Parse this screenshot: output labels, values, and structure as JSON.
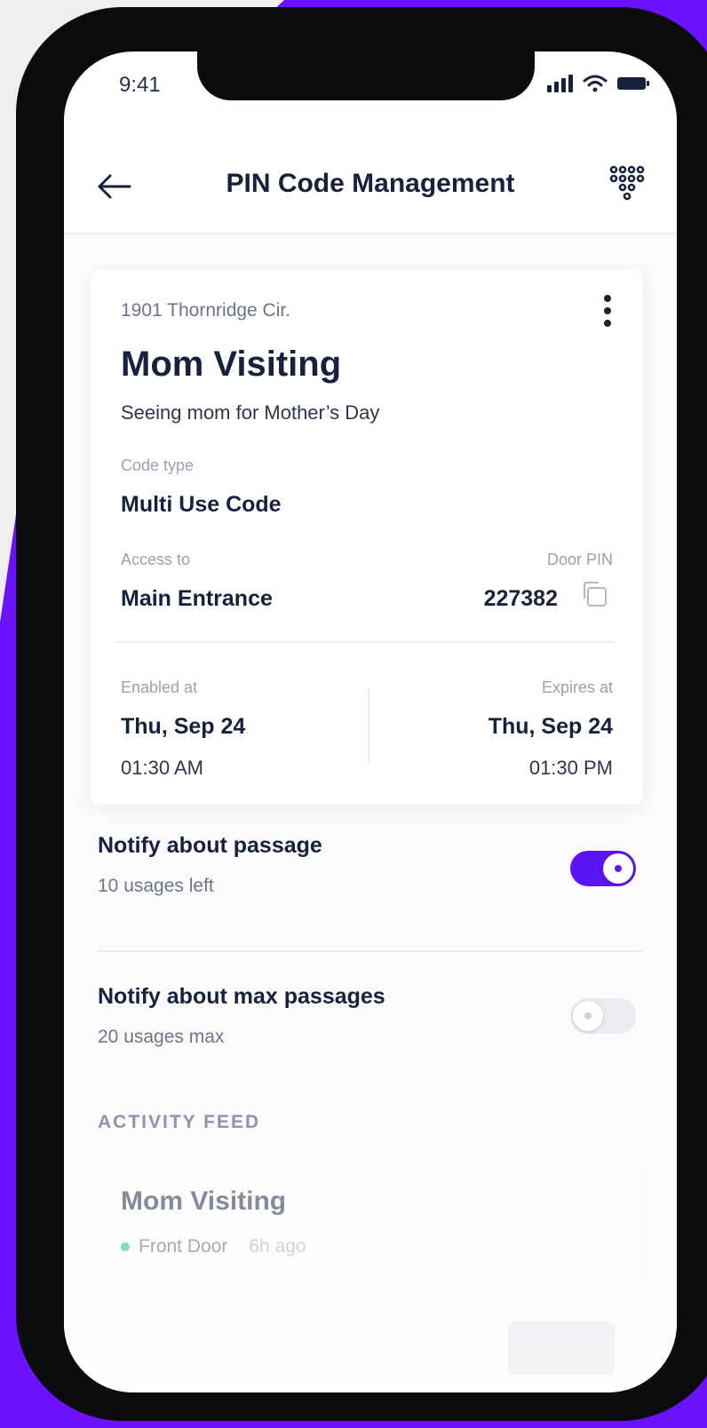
{
  "status_bar": {
    "time": "9:41"
  },
  "header": {
    "title": "PIN Code Management"
  },
  "card": {
    "address": "1901 Thornridge Cir.",
    "name": "Mom Visiting",
    "description": "Seeing mom for Mother’s Day",
    "code_type_label": "Code type",
    "code_type_value": "Multi Use Code",
    "access_label": "Access to",
    "access_value": "Main Entrance",
    "pin_label": "Door PIN",
    "pin_value": "227382",
    "enabled_label": "Enabled at",
    "enabled_date": "Thu, Sep 24",
    "enabled_time": "01:30 AM",
    "expires_label": "Expires at",
    "expires_date": "Thu, Sep 24",
    "expires_time": "01:30 PM"
  },
  "settings": [
    {
      "title": "Notify about passage",
      "subtitle": "10 usages left",
      "enabled": true
    },
    {
      "title": "Notify about max passages",
      "subtitle": "20 usages max",
      "enabled": false
    }
  ],
  "activity": {
    "section_title": "ACTIVITY FEED",
    "items": [
      {
        "title": "Mom Visiting",
        "location": "Front Door",
        "time": "6h ago"
      }
    ]
  },
  "colors": {
    "accent": "#5b14f5",
    "background_purple": "#6b12ff",
    "text_primary": "#17213d",
    "status_online": "#2ecf8a"
  }
}
